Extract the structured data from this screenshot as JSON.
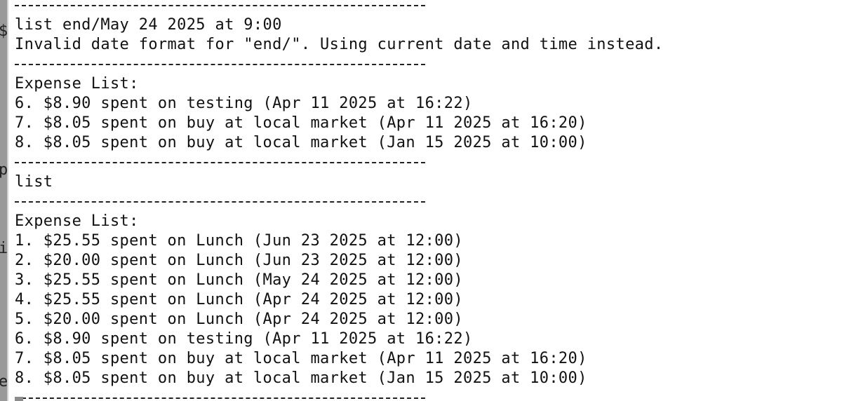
{
  "terminal": {
    "lines": [
      {
        "kind": "separator"
      },
      {
        "kind": "text",
        "text": "list end/May 24 2025 at 9:00"
      },
      {
        "kind": "text",
        "text": "Invalid date format for \"end/\". Using current date and time instead."
      },
      {
        "kind": "separator"
      },
      {
        "kind": "text",
        "text": "Expense List:"
      },
      {
        "kind": "text",
        "text": "6. $8.90 spent on testing (Apr 11 2025 at 16:22)"
      },
      {
        "kind": "text",
        "text": "7. $8.05 spent on buy at local market (Apr 11 2025 at 16:20)"
      },
      {
        "kind": "text",
        "text": "8. $8.05 spent on buy at local market (Jan 15 2025 at 10:00)"
      },
      {
        "kind": "separator"
      },
      {
        "kind": "text",
        "text": "list"
      },
      {
        "kind": "separator"
      },
      {
        "kind": "text",
        "text": "Expense List:"
      },
      {
        "kind": "text",
        "text": "1. $25.55 spent on Lunch (Jun 23 2025 at 12:00)"
      },
      {
        "kind": "text",
        "text": "2. $20.00 spent on Lunch (Jun 23 2025 at 12:00)"
      },
      {
        "kind": "text",
        "text": "3. $25.55 spent on Lunch (May 24 2025 at 12:00)"
      },
      {
        "kind": "text",
        "text": "4. $25.55 spent on Lunch (Apr 24 2025 at 12:00)"
      },
      {
        "kind": "text",
        "text": "5. $20.00 spent on Lunch (Apr 24 2025 at 12:00)"
      },
      {
        "kind": "text",
        "text": "6. $8.90 spent on testing (Apr 11 2025 at 16:22)"
      },
      {
        "kind": "text",
        "text": "7. $8.05 spent on buy at local market (Apr 11 2025 at 16:20)"
      },
      {
        "kind": "text",
        "text": "8. $8.05 spent on buy at local market (Jan 15 2025 at 10:00)"
      },
      {
        "kind": "separator"
      }
    ]
  },
  "gutter": {
    "glyphs": [
      "$",
      "p",
      "i",
      "e"
    ]
  },
  "colors": {
    "background": "#ffffff",
    "text": "#111111",
    "gutter": "#9a9a9a"
  }
}
